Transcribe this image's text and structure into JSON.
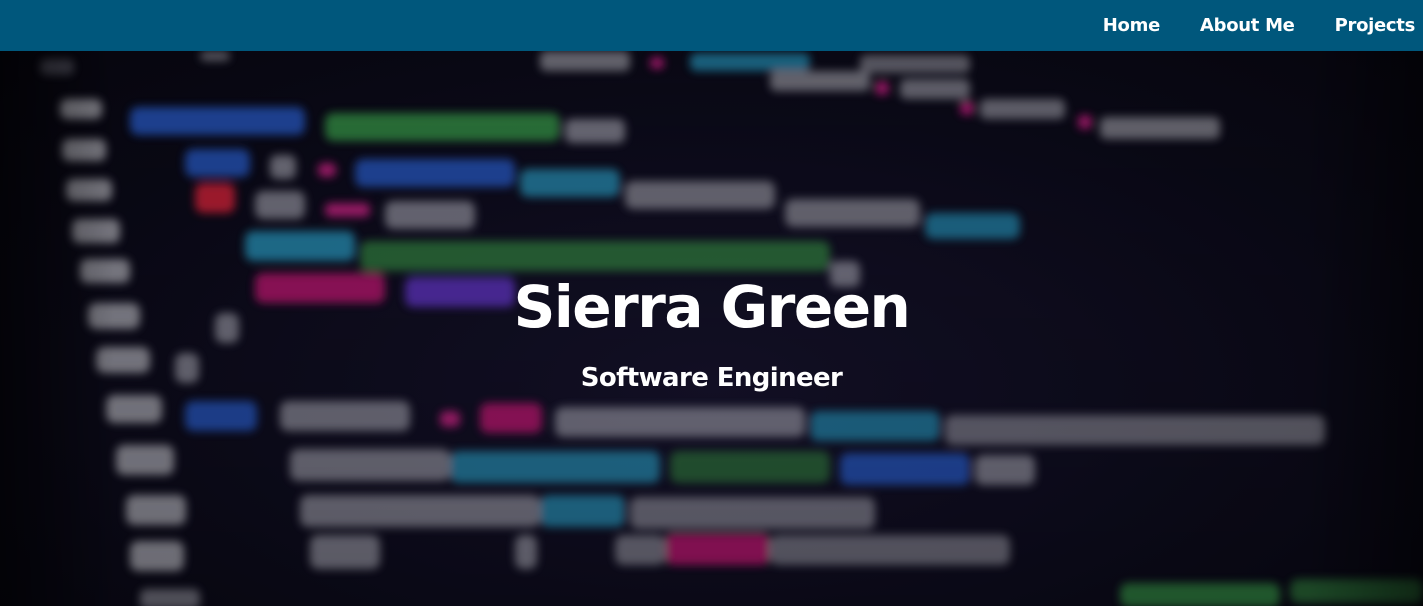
{
  "nav": {
    "items": [
      {
        "label": "Home"
      },
      {
        "label": "About Me"
      },
      {
        "label": "Projects"
      }
    ]
  },
  "hero": {
    "name": "Sierra Green",
    "title": "Software Engineer"
  },
  "colors": {
    "navbar_bg": "#00577c",
    "text": "#ffffff",
    "hero_bg": "#0b0a16"
  }
}
